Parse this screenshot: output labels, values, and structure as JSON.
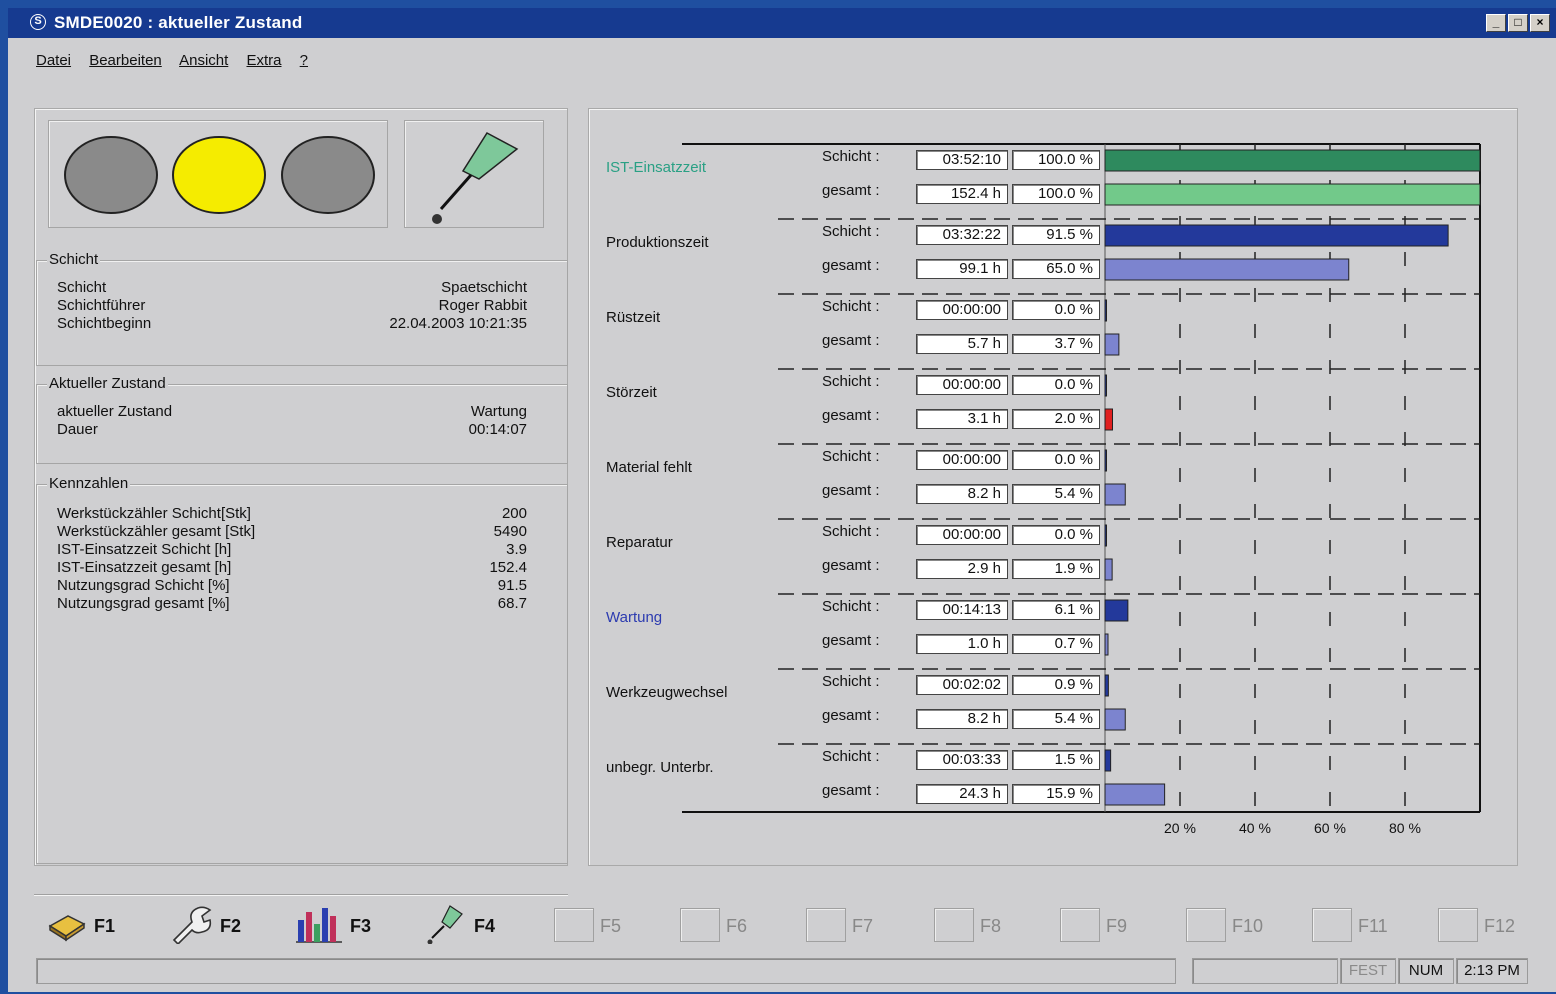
{
  "window": {
    "title": "SMDE0020 : aktueller Zustand",
    "controls": [
      "_",
      "□",
      "×"
    ]
  },
  "menu": [
    "Datei",
    "Bearbeiten",
    "Ansicht",
    "Extra",
    "?"
  ],
  "traffic_light": {
    "active": "yellow",
    "colors": {
      "off": "#8a8a8a",
      "yellow": "#f5ec00"
    }
  },
  "schicht": {
    "title": "Schicht",
    "rows": [
      {
        "label": "Schicht",
        "value": "Spaetschicht"
      },
      {
        "label": "Schichtführer",
        "value": "Roger Rabbit"
      },
      {
        "label": "Schichtbeginn",
        "value": "22.04.2003 10:21:35"
      }
    ]
  },
  "zustand": {
    "title": "Aktueller Zustand",
    "rows": [
      {
        "label": "aktueller Zustand",
        "value": "Wartung"
      },
      {
        "label": "Dauer",
        "value": "00:14:07"
      }
    ]
  },
  "kennzahlen": {
    "title": "Kennzahlen",
    "rows": [
      {
        "label": "Werkstückzähler Schicht[Stk]",
        "value": "200"
      },
      {
        "label": "Werkstückzähler gesamt [Stk]",
        "value": "5490"
      },
      {
        "label": "IST-Einsatzzeit Schicht [h]",
        "value": "3.9"
      },
      {
        "label": "IST-Einsatzzeit gesamt [h]",
        "value": "152.4"
      },
      {
        "label": "Nutzungsgrad Schicht [%]",
        "value": "91.5"
      },
      {
        "label": "Nutzungsgrad gesamt [%]",
        "value": "68.7"
      }
    ]
  },
  "chart_data": {
    "type": "bar",
    "orientation": "horizontal",
    "sub_labels": {
      "shift": "Schicht :",
      "total": "gesamt :"
    },
    "xlim": [
      0,
      100
    ],
    "x_ticks": [
      "20 %",
      "40 %",
      "60 %",
      "80 %"
    ],
    "grid": true,
    "categories": [
      {
        "name": "IST-Einsatzzeit",
        "name_color": "#2aa084",
        "shift": {
          "time": "03:52:10",
          "pct": "100.0 %",
          "value": 100.0,
          "color": "#2e8a5e"
        },
        "total": {
          "time": "152.4 h",
          "pct": "100.0 %",
          "value": 100.0,
          "color": "#72c98a"
        }
      },
      {
        "name": "Produktionszeit",
        "name_color": "#111111",
        "shift": {
          "time": "03:32:22",
          "pct": "91.5 %",
          "value": 91.5,
          "color": "#23399b"
        },
        "total": {
          "time": "99.1 h",
          "pct": "65.0 %",
          "value": 65.0,
          "color": "#7c84cf"
        }
      },
      {
        "name": "Rüstzeit",
        "name_color": "#111111",
        "shift": {
          "time": "00:00:00",
          "pct": "0.0 %",
          "value": 0.0,
          "color": "#23399b"
        },
        "total": {
          "time": "5.7 h",
          "pct": "3.7 %",
          "value": 3.7,
          "color": "#7c84cf"
        }
      },
      {
        "name": "Störzeit",
        "name_color": "#111111",
        "shift": {
          "time": "00:00:00",
          "pct": "0.0 %",
          "value": 0.0,
          "color": "#23399b"
        },
        "total": {
          "time": "3.1 h",
          "pct": "2.0 %",
          "value": 2.0,
          "color": "#e02020"
        }
      },
      {
        "name": "Material fehlt",
        "name_color": "#111111",
        "shift": {
          "time": "00:00:00",
          "pct": "0.0 %",
          "value": 0.0,
          "color": "#23399b"
        },
        "total": {
          "time": "8.2 h",
          "pct": "5.4 %",
          "value": 5.4,
          "color": "#7c84cf"
        }
      },
      {
        "name": "Reparatur",
        "name_color": "#111111",
        "shift": {
          "time": "00:00:00",
          "pct": "0.0 %",
          "value": 0.0,
          "color": "#23399b"
        },
        "total": {
          "time": "2.9 h",
          "pct": "1.9 %",
          "value": 1.9,
          "color": "#7c84cf"
        }
      },
      {
        "name": "Wartung",
        "name_color": "#2c3bb0",
        "shift": {
          "time": "00:14:13",
          "pct": "6.1 %",
          "value": 6.1,
          "color": "#23399b"
        },
        "total": {
          "time": "1.0 h",
          "pct": "0.7 %",
          "value": 0.7,
          "color": "#7c84cf"
        }
      },
      {
        "name": "Werkzeugwechsel",
        "name_color": "#111111",
        "shift": {
          "time": "00:02:02",
          "pct": "0.9 %",
          "value": 0.9,
          "color": "#23399b"
        },
        "total": {
          "time": "8.2 h",
          "pct": "5.4 %",
          "value": 5.4,
          "color": "#7c84cf"
        }
      },
      {
        "name": "unbegr. Unterbr.",
        "name_color": "#111111",
        "shift": {
          "time": "00:03:33",
          "pct": "1.5 %",
          "value": 1.5,
          "color": "#23399b"
        },
        "total": {
          "time": "24.3 h",
          "pct": "15.9 %",
          "value": 15.9,
          "color": "#7c84cf"
        }
      }
    ]
  },
  "fkeys": [
    {
      "label": "F1",
      "icon": "book-icon",
      "enabled": true
    },
    {
      "label": "F2",
      "icon": "wrench-icon",
      "enabled": true
    },
    {
      "label": "F3",
      "icon": "bar-chart-icon",
      "enabled": true
    },
    {
      "label": "F4",
      "icon": "pen-icon",
      "enabled": true
    },
    {
      "label": "F5",
      "enabled": false
    },
    {
      "label": "F6",
      "enabled": false
    },
    {
      "label": "F7",
      "enabled": false
    },
    {
      "label": "F8",
      "enabled": false
    },
    {
      "label": "F9",
      "enabled": false
    },
    {
      "label": "F10",
      "enabled": false
    },
    {
      "label": "F11",
      "enabled": false
    },
    {
      "label": "F12",
      "enabled": false
    }
  ],
  "statusbar": {
    "fest": "FEST",
    "num": "NUM",
    "time": "2:13 PM"
  }
}
